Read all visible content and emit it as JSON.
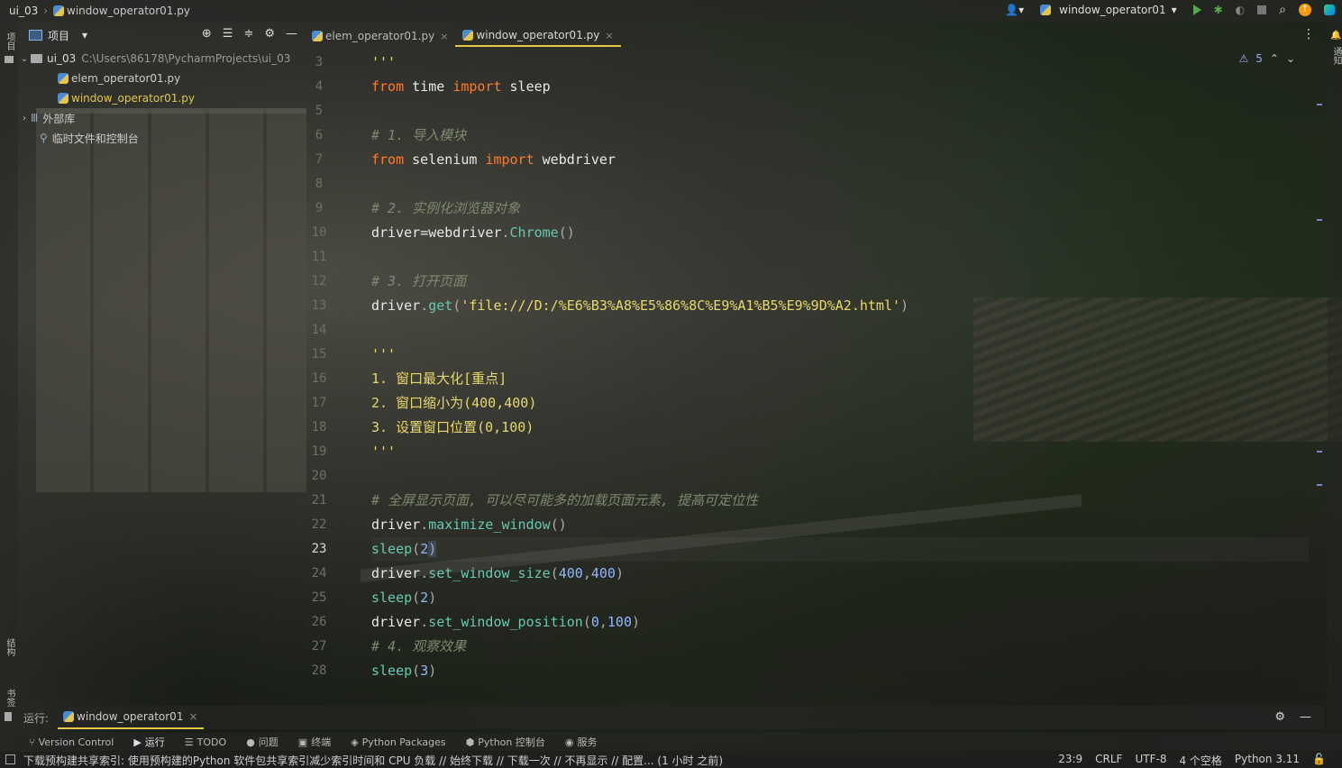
{
  "topbar": {
    "project": "ui_03",
    "file": "window_operator01.py",
    "run_config": "window_operator01"
  },
  "left_strip": {
    "project_tool": "项目",
    "structure_tool": "结构",
    "bookmarks_tool": "书签"
  },
  "right_strip": {
    "notifications_tool": "通知"
  },
  "project_panel": {
    "title": "项目",
    "tree": [
      {
        "name": "ui_03",
        "path": "C:\\Users\\86178\\PycharmProjects\\ui_03"
      },
      {
        "name": "elem_operator01.py"
      },
      {
        "name": "window_operator01.py"
      },
      {
        "name": "外部库"
      },
      {
        "name": "临时文件和控制台"
      }
    ]
  },
  "editor": {
    "tabs": [
      {
        "label": "elem_operator01.py",
        "active": false
      },
      {
        "label": "window_operator01.py",
        "active": true
      }
    ],
    "warnings_count": "5",
    "line_numbers": [
      "3",
      "4",
      "5",
      "6",
      "7",
      "8",
      "9",
      "10",
      "11",
      "12",
      "13",
      "14",
      "15",
      "16",
      "17",
      "18",
      "19",
      "20",
      "21",
      "22",
      "23",
      "24",
      "25",
      "26",
      "27",
      "28"
    ],
    "current_line": "23",
    "code": {
      "l3": "'''",
      "l4_kw1": "from",
      "l4_a": " time ",
      "l4_kw2": "import",
      "l4_b": " sleep",
      "l6": "# 1. 导入模块",
      "l7_kw1": "from",
      "l7_a": " selenium ",
      "l7_kw2": "import",
      "l7_b": " webdriver",
      "l9": "# 2. 实例化浏览器对象",
      "l10_a": "driver",
      "l10_eq": "=",
      "l10_b": "webdriver",
      "l10_dot": ".",
      "l10_fn": "Chrome",
      "l10_p": "()",
      "l12": "# 3. 打开页面",
      "l13_a": "driver",
      "l13_dot": ".",
      "l13_fn": "get",
      "l13_p1": "(",
      "l13_str": "'file:///D:/%E6%B3%A8%E5%86%8C%E9%A1%B5%E9%9D%A2.html'",
      "l13_p2": ")",
      "l15": "'''",
      "l16": "1. 窗口最大化[重点]",
      "l17": "2. 窗口缩小为(400,400)",
      "l18": "3. 设置窗口位置(0,100)",
      "l19": "'''",
      "l21": "# 全屏显示页面, 可以尽可能多的加载页面元素, 提高可定位性",
      "l22_a": "driver",
      "l22_dot": ".",
      "l22_fn": "maximize_window",
      "l22_p": "()",
      "l23_fn": "sleep",
      "l23_p1": "(",
      "l23_n": "2",
      "l23_p2": ")",
      "l24_a": "driver",
      "l24_dot": ".",
      "l24_fn": "set_window_size",
      "l24_p1": "(",
      "l24_n1": "400",
      "l24_c": ",",
      "l24_n2": "400",
      "l24_p2": ")",
      "l25_fn": "sleep",
      "l25_p1": "(",
      "l25_n": "2",
      "l25_p2": ")",
      "l26_a": "driver",
      "l26_dot": ".",
      "l26_fn": "set_window_position",
      "l26_p1": "(",
      "l26_n1": "0",
      "l26_c": ",",
      "l26_n2": "100",
      "l26_p2": ")",
      "l27": "# 4. 观察效果",
      "l28_fn": "sleep",
      "l28_p1": "(",
      "l28_n": "3",
      "l28_p2": ")"
    }
  },
  "run_panel": {
    "label": "运行:",
    "tab": "window_operator01"
  },
  "tool_windows": [
    {
      "label": "Version Control",
      "icon": "branch-icon"
    },
    {
      "label": "运行",
      "icon": "play-icon"
    },
    {
      "label": "TODO",
      "icon": "list-icon"
    },
    {
      "label": "问题",
      "icon": "info-icon"
    },
    {
      "label": "终端",
      "icon": "terminal-icon"
    },
    {
      "label": "Python Packages",
      "icon": "layers-icon"
    },
    {
      "label": "Python 控制台",
      "icon": "python-icon"
    },
    {
      "label": "服务",
      "icon": "services-icon"
    }
  ],
  "status": {
    "message": "下载预构建共享索引: 使用预构建的Python 软件包共享索引减少索引时间和 CPU 负载 // 始终下载 // 下载一次 // 不再显示 // 配置... (1 小时 之前)",
    "position": "23:9",
    "line_sep": "CRLF",
    "encoding": "UTF-8",
    "indent": "4 个空格",
    "interpreter": "Python 3.11"
  },
  "colors": {
    "keyword": "#ff7a2a",
    "comment": "#7e8a6d",
    "string": "#e8d96a",
    "function": "#67c9b1",
    "number": "#8fb8ff",
    "accent": "#e5c54a"
  }
}
